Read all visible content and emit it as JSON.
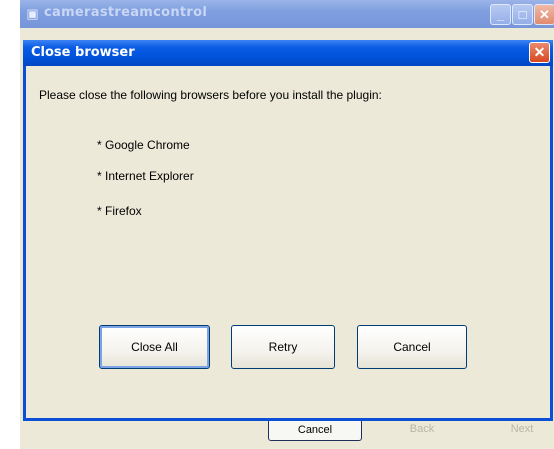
{
  "background_window": {
    "title": "camerastreamcontrol",
    "app_icon": "installer-icon",
    "buttons": {
      "cancel": "Cancel",
      "back": "Back",
      "next": "Next"
    }
  },
  "dialog": {
    "title": "Close browser",
    "close_glyph": "✕",
    "message": "Please close the following browsers before you install the plugin:",
    "browsers": [
      "*  Google Chrome",
      "*  Internet Explorer",
      "*  Firefox"
    ],
    "buttons": {
      "close_all": "Close All",
      "retry": "Retry",
      "cancel": "Cancel"
    }
  },
  "colors": {
    "dialog_title_bar": "#0054e3",
    "window_face": "#ece9d8",
    "close_button": "#d8471f"
  }
}
